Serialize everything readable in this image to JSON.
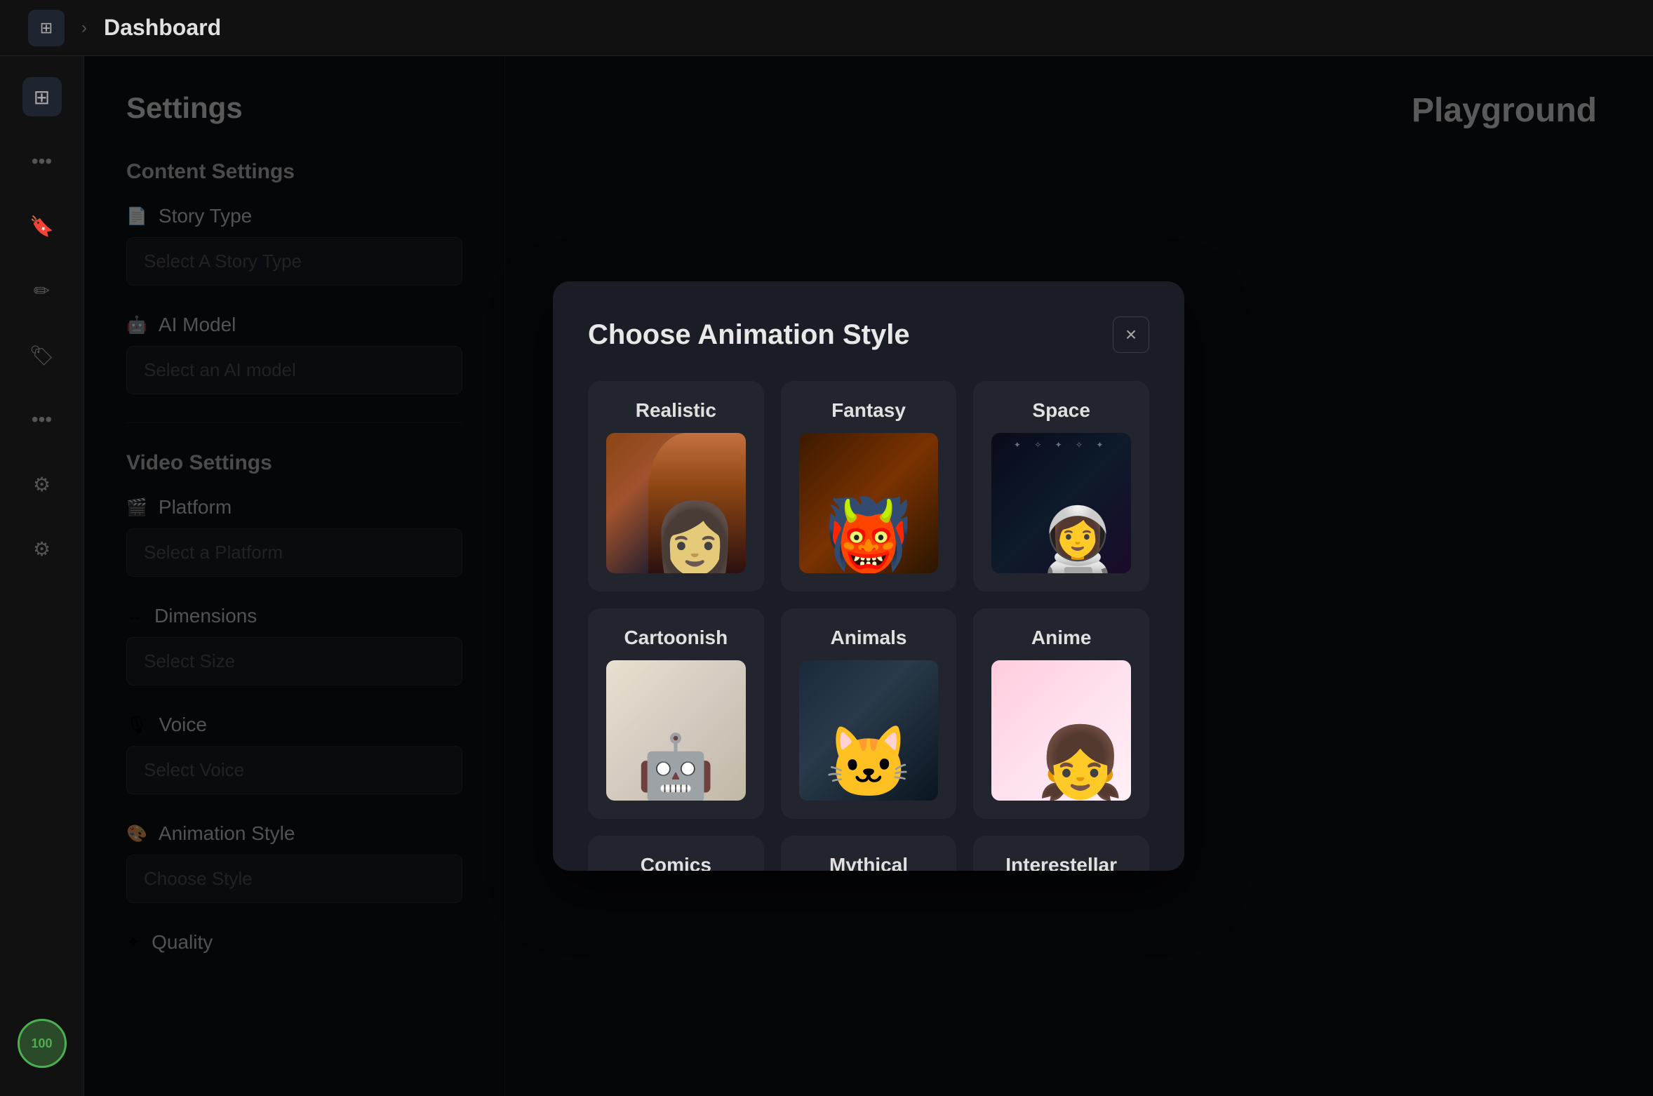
{
  "topbar": {
    "icon_label": "⊞",
    "chevron": "›",
    "title": "Dashboard",
    "right_title": "Playground"
  },
  "sidebar": {
    "icons": [
      {
        "name": "grid-icon",
        "symbol": "⊞",
        "active": true
      },
      {
        "name": "dots-icon",
        "symbol": "•••"
      },
      {
        "name": "bookmark-icon",
        "symbol": "🔖"
      },
      {
        "name": "edit-icon",
        "symbol": "✏️"
      },
      {
        "name": "tag-icon",
        "symbol": "🏷"
      },
      {
        "name": "dots2-icon",
        "symbol": "•••"
      },
      {
        "name": "gear-icon",
        "symbol": "⚙"
      },
      {
        "name": "settings2-icon",
        "symbol": "⚙"
      }
    ],
    "avatar_label": "100"
  },
  "settings": {
    "title": "Settings",
    "content_section": "Content Settings",
    "story_type": {
      "label": "Story Type",
      "icon": "📄",
      "placeholder": "Select A Story Type"
    },
    "ai_model": {
      "label": "AI Model",
      "icon": "🤖",
      "placeholder": "Select an AI model"
    },
    "video_section": "Video Settings",
    "platform": {
      "label": "Platform",
      "icon": "🎬",
      "placeholder": "Select a Platform"
    },
    "dimensions": {
      "label": "Dimensions",
      "icon": "↔",
      "placeholder": "Select Size"
    },
    "voice": {
      "label": "Voice",
      "icon": "🎙",
      "placeholder": "Select Voice"
    },
    "animation_style": {
      "label": "Animation Style",
      "icon": "🎨",
      "placeholder": "Choose Style"
    },
    "quality": {
      "label": "Quality",
      "icon": "✦"
    }
  },
  "modal": {
    "title": "Choose Animation Style",
    "close_label": "×",
    "styles": [
      {
        "id": "realistic",
        "label": "Realistic",
        "img_class": "img-realistic"
      },
      {
        "id": "fantasy",
        "label": "Fantasy",
        "img_class": "img-fantasy"
      },
      {
        "id": "space",
        "label": "Space",
        "img_class": "img-space"
      },
      {
        "id": "cartoonish",
        "label": "Cartoonish",
        "img_class": "img-cartoonish"
      },
      {
        "id": "animals",
        "label": "Animals",
        "img_class": "img-animals"
      },
      {
        "id": "anime",
        "label": "Anime",
        "img_class": "img-anime"
      },
      {
        "id": "comics",
        "label": "Comics",
        "img_class": "img-comics"
      },
      {
        "id": "mythical",
        "label": "Mythical",
        "img_class": "img-mythical"
      },
      {
        "id": "interestellar",
        "label": "Interestellar",
        "img_class": "img-interestellar"
      }
    ]
  }
}
